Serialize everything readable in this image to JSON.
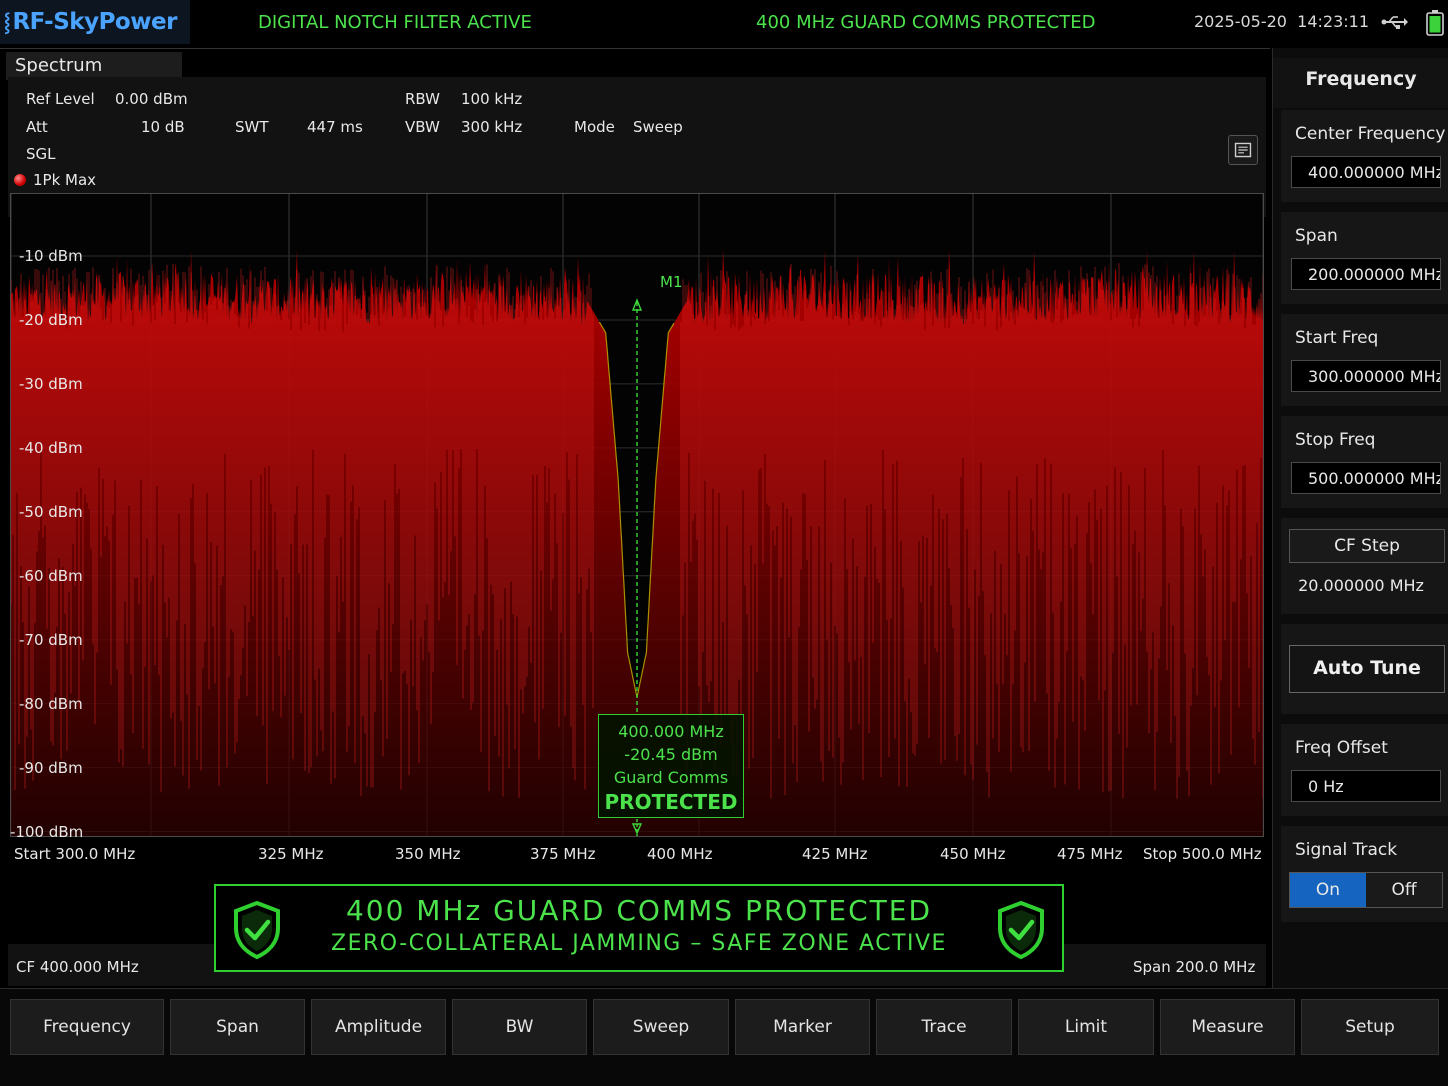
{
  "header": {
    "brand": "RF-SkyPower",
    "status_left": "DIGITAL NOTCH FILTER ACTIVE",
    "status_right": "400 MHz GUARD COMMS PROTECTED",
    "date": "2025-05-20",
    "time": "14:23:11"
  },
  "spectrum": {
    "tab_label": "Spectrum",
    "ref_level_label": "Ref Level",
    "ref_level_value": "0.00 dBm",
    "att_label": "Att",
    "att_value": "10 dB",
    "swt_label": "SWT",
    "swt_value": "447 ms",
    "rbw_label": "RBW",
    "rbw_value": "100 kHz",
    "vbw_label": "VBW",
    "vbw_value": "300 kHz",
    "mode_label": "Mode",
    "mode_value": "Sweep",
    "sgl_label": "SGL",
    "trace_label": "1Pk Max",
    "cf_readout": "CF  400.000 MHz",
    "span_readout": "Span  200.0 MHz"
  },
  "marker": {
    "label": "M1",
    "frequency": "400.000 MHz",
    "level": "-20.45 dBm",
    "note": "Guard Comms",
    "status": "PROTECTED"
  },
  "banner": {
    "title": "400  MHz  GUARD  COMMS  PROTECTED",
    "subtitle": "ZERO-COLLATERAL JAMMING – SAFE  ZONE  ACTIVE"
  },
  "chart_data": {
    "type": "line",
    "title": "",
    "x_unit": "MHz",
    "y_unit": "dBm",
    "xlim": [
      300,
      500
    ],
    "ylim": [
      -100,
      0
    ],
    "y_ticks": [
      "-10  dBm",
      "-20  dBm",
      "-30  dBm",
      "-40  dBm",
      "-50  dBm",
      "-60  dBm",
      "-70  dBm",
      "-80  dBm",
      "-90  dBm",
      "-100  dBm"
    ],
    "x_ticks": [
      "Start  300.0 MHz",
      "325 MHz",
      "350 MHz",
      "375 MHz",
      "400 MHz",
      "425 MHz",
      "450 MHz",
      "475 MHz",
      "Stop 500.0 MHz"
    ],
    "grid": true,
    "series": [
      {
        "name": "1Pk Max",
        "color": "#e01010",
        "noise_peak_dbm": -16,
        "noise_floor_dbm": -100,
        "notch_center_mhz": 400,
        "notch_depth_dbm": -79,
        "x": [
          300,
          325,
          350,
          375,
          392,
          395,
          397,
          398.5,
          400,
          401.5,
          403,
          405,
          408,
          425,
          450,
          475,
          500
        ],
        "y": [
          -17,
          -16,
          -17,
          -16,
          -17,
          -22,
          -45,
          -72,
          -79,
          -72,
          -45,
          -22,
          -17,
          -16,
          -17,
          -16,
          -17
        ]
      }
    ]
  },
  "right_panel": {
    "title": "Frequency",
    "center_freq_label": "Center Frequency",
    "center_freq_value": "400.000000 MHz",
    "span_label": "Span",
    "span_value": "200.000000 MHz",
    "start_label": "Start Freq",
    "start_value": "300.000000 MHz",
    "stop_label": "Stop Freq",
    "stop_value": "500.000000 MHz",
    "cf_step_label": "CF Step",
    "cf_step_value": "20.000000 MHz",
    "auto_tune_label": "Auto Tune",
    "freq_offset_label": "Freq Offset",
    "freq_offset_value": "0 Hz",
    "signal_track_label": "Signal Track",
    "signal_track_on": "On",
    "signal_track_off": "Off",
    "signal_track_state": "On"
  },
  "softkeys": [
    "Frequency",
    "Span",
    "Amplitude",
    "BW",
    "Sweep",
    "Marker",
    "Trace",
    "Limit",
    "Measure",
    "Setup"
  ],
  "colors": {
    "accent_green": "#4ce24c",
    "brand_blue": "#4aa3ff",
    "trace_red": "#e01010",
    "toggle_on_blue": "#1565c0"
  }
}
